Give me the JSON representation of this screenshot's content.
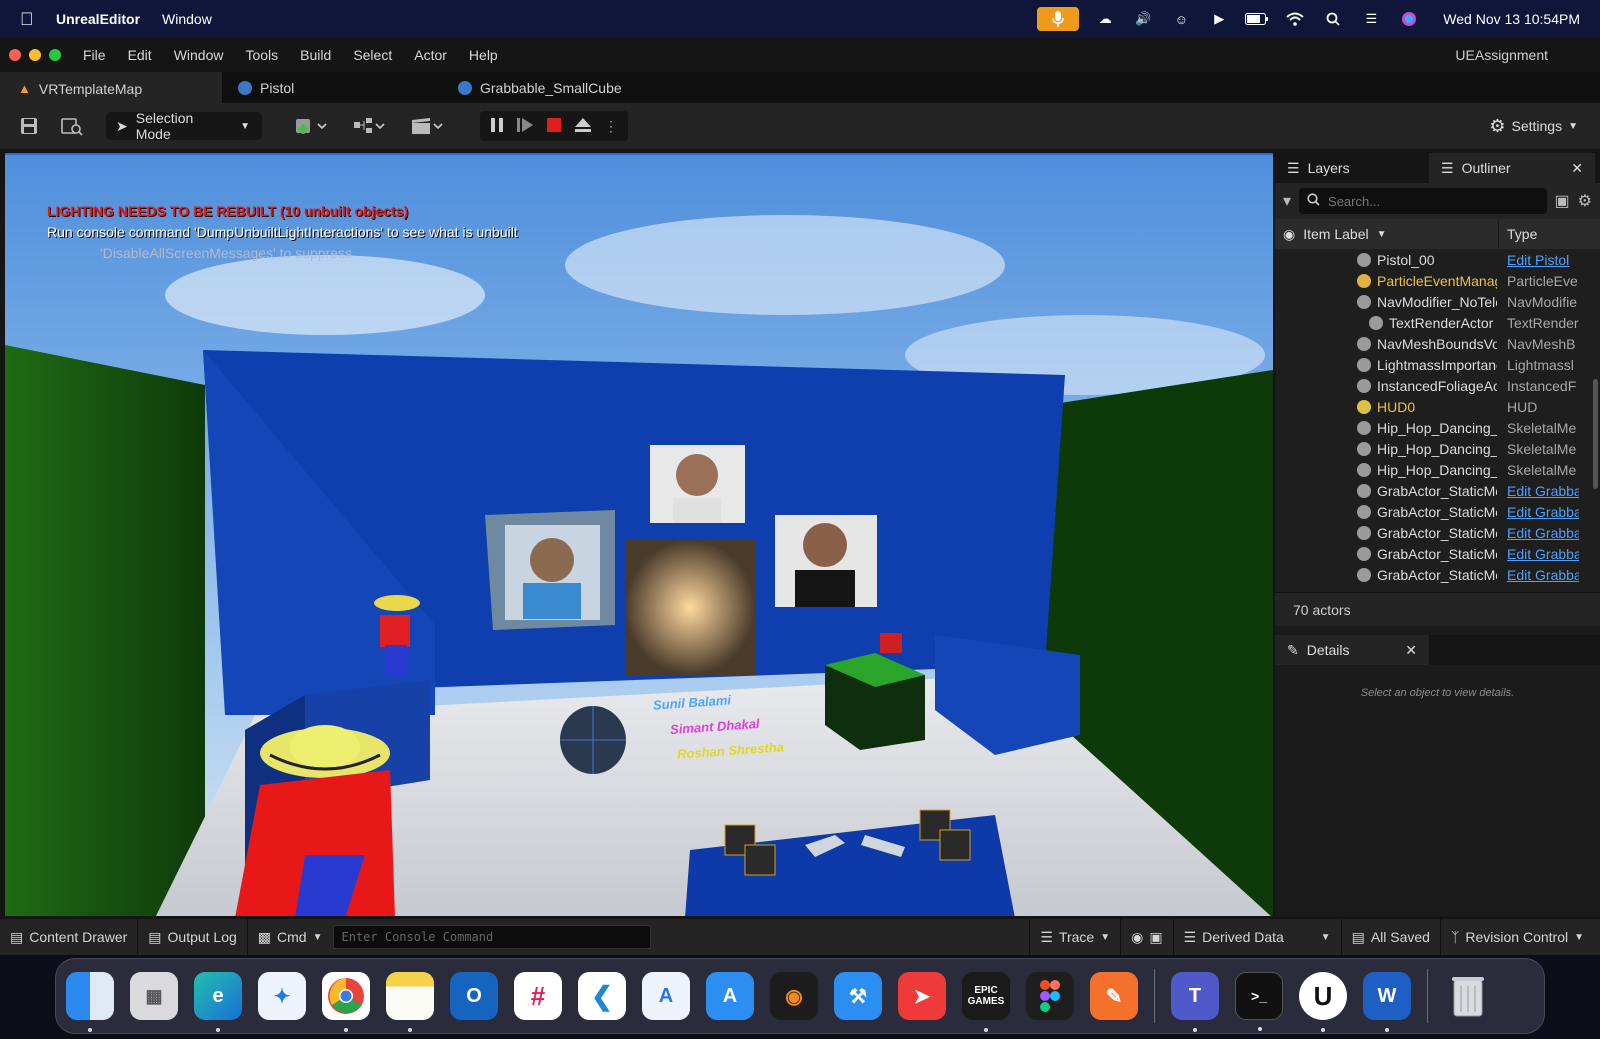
{
  "mac_menubar": {
    "app_name": "UnrealEditor",
    "menu_window": "Window",
    "datetime": "Wed Nov 13  10:54PM"
  },
  "window": {
    "menus": [
      "File",
      "Edit",
      "Window",
      "Tools",
      "Build",
      "Select",
      "Actor",
      "Help"
    ],
    "project_name": "UEAssignment",
    "tabs": [
      {
        "label": "VRTemplateMap"
      },
      {
        "label": "Pistol"
      },
      {
        "label": "Grabbable_SmallCube"
      }
    ],
    "selection_mode_label": "Selection Mode",
    "settings_label": "Settings"
  },
  "viewport": {
    "msg_lighting": "LIGHTING NEEDS TO BE REBUILT (10 unbuilt objects)",
    "msg_console": "Run console command 'DumpUnbuiltLightInteractions' to see what is unbuilt",
    "msg_suppress": "'DisableAllScreenMessages' to suppress",
    "name1": "Sunil Balami",
    "name2": "Simant Dhakal",
    "name3": "Roshan Shrestha"
  },
  "outliner": {
    "tab_layers": "Layers",
    "tab_outliner": "Outliner",
    "search_placeholder": "Search...",
    "col_label": "Item Label",
    "col_type": "Type",
    "rows": [
      {
        "label": "Pistol_00",
        "type": "Edit Pistol",
        "link": true
      },
      {
        "label": "ParticleEventManager",
        "type": "ParticleEve",
        "link": false
      },
      {
        "label": "NavModifier_NoTelep",
        "type": "NavModifie",
        "link": false
      },
      {
        "label": "TextRenderActor",
        "type": "TextRender",
        "link": false
      },
      {
        "label": "NavMeshBoundsVolu",
        "type": "NavMeshB",
        "link": false
      },
      {
        "label": "LightmassImportance",
        "type": "Lightmassl",
        "link": false
      },
      {
        "label": "InstancedFoliageActo",
        "type": "InstancedF",
        "link": false
      },
      {
        "label": "HUD0",
        "type": "HUD",
        "link": false
      },
      {
        "label": "Hip_Hop_Dancing_An",
        "type": "SkeletalMe",
        "link": false
      },
      {
        "label": "Hip_Hop_Dancing_An",
        "type": "SkeletalMe",
        "link": false
      },
      {
        "label": "Hip_Hop_Dancing_An",
        "type": "SkeletalMe",
        "link": false
      },
      {
        "label": "GrabActor_StaticMesl",
        "type": "Edit Grabba",
        "link": true
      },
      {
        "label": "GrabActor_StaticMesl",
        "type": "Edit Grabba",
        "link": true
      },
      {
        "label": "GrabActor_StaticMesl",
        "type": "Edit Grabba",
        "link": true
      },
      {
        "label": "GrabActor_StaticMesl",
        "type": "Edit Grabba",
        "link": true
      },
      {
        "label": "GrabActor_StaticMesl",
        "type": "Edit Grabba",
        "link": true
      }
    ],
    "actor_count": "70 actors"
  },
  "details": {
    "tab_label": "Details",
    "empty_text": "Select an object to view details."
  },
  "statusbar": {
    "content_drawer": "Content Drawer",
    "output_log": "Output Log",
    "cmd": "Cmd",
    "console_placeholder": "Enter Console Command",
    "trace": "Trace",
    "derived_data": "Derived Data",
    "all_saved": "All Saved",
    "revision_control": "Revision Control"
  },
  "dock": {
    "epic_label": "EPIC GAMES",
    "apps": [
      "finder",
      "launchpad",
      "edge",
      "safari",
      "chrome",
      "notes",
      "outlook",
      "slack",
      "vscode",
      "instruments",
      "xcode-simulator",
      "blender",
      "xcode",
      "anydesk",
      "epic-games",
      "figma",
      "sketch-pen",
      "teams",
      "terminal",
      "unreal",
      "word",
      "trash"
    ]
  },
  "colors": {
    "menubar_bg": "#10163a",
    "accent_blue": "#2e6bd0",
    "link_blue": "#4ea0ff",
    "warning_red": "#d92020",
    "mic_orange": "#f09a1d"
  }
}
